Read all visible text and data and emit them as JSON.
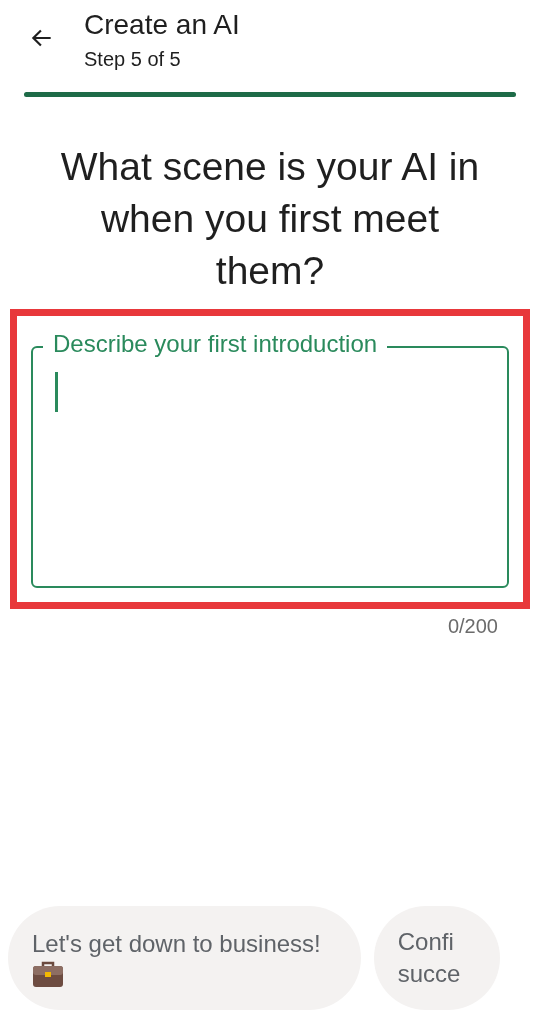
{
  "header": {
    "title": "Create an AI",
    "subtitle": "Step 5 of 5"
  },
  "progress": {
    "level": 1
  },
  "question": "What scene is your AI in when you first meet them?",
  "field": {
    "label": "Describe your first introduction",
    "focused": true,
    "highlighted": true,
    "counter": "0/200"
  },
  "suggestions": [
    {
      "lines": [
        "Let's get down to business!"
      ],
      "has_icon": true
    },
    {
      "lines": [
        "Confi",
        "succe"
      ],
      "has_icon": false
    }
  ]
}
